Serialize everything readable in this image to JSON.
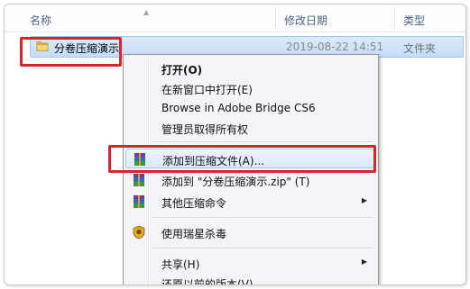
{
  "header": {
    "col_name": "名称",
    "col_date": "修改日期",
    "col_type": "类型"
  },
  "file": {
    "name": "分卷压缩演示",
    "date": "2019-08-22 14:51",
    "type": "文件夹"
  },
  "menu": {
    "items": [
      {
        "label": "打开(O)",
        "icon": "none"
      },
      {
        "label": "在新窗口中打开(E)",
        "icon": "none"
      },
      {
        "label": "Browse in Adobe Bridge CS6",
        "icon": "none"
      },
      {
        "label": "管理员取得所有权",
        "icon": "none"
      },
      {
        "label": "添加到压缩文件(A)...",
        "icon": "winrar-icon"
      },
      {
        "label": "添加到 \"分卷压缩演示.zip\" (T)",
        "icon": "winrar-icon"
      },
      {
        "label": "其他压缩命令",
        "icon": "winrar-icon"
      },
      {
        "label": "使用瑞星杀毒",
        "icon": "rising-antivirus-icon"
      },
      {
        "label": "共享(H)",
        "icon": "none"
      },
      {
        "label": "还原以前的版本(V)",
        "icon": "none"
      }
    ]
  },
  "colors": {
    "highlight_border": "#d9252a",
    "selection_bg": "#c5dcf7",
    "menu_bg": "#f3f4f7"
  }
}
